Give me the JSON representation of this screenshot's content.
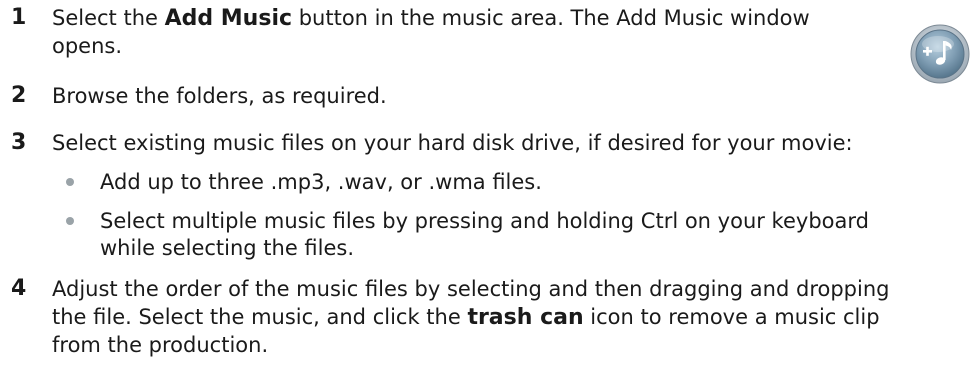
{
  "steps": [
    {
      "number": "1",
      "line1_pre": "Select the ",
      "line1_bold": "Add Music",
      "line1_post": " button in the music area. The Add Music window",
      "line2": "opens."
    },
    {
      "number": "2",
      "line1": "Browse the folders, as required."
    },
    {
      "number": "3",
      "line1": "Select existing music files on your hard disk drive, if desired for your movie:",
      "bullets": [
        {
          "line1": "Add up to three .mp3, .wav, or .wma files."
        },
        {
          "line1": "Select multiple music files by pressing and holding Ctrl on your keyboard",
          "line2": "while selecting the files."
        }
      ]
    },
    {
      "number": "4",
      "line1": "Adjust the order of the music files by selecting and then dragging and dropping",
      "line2_pre": "the file. Select the music, and click the ",
      "line2_bold": "trash can",
      "line2_post": " icon to remove a music clip",
      "line3": "from the production."
    }
  ],
  "icons": {
    "add_music": "add-music-icon"
  }
}
